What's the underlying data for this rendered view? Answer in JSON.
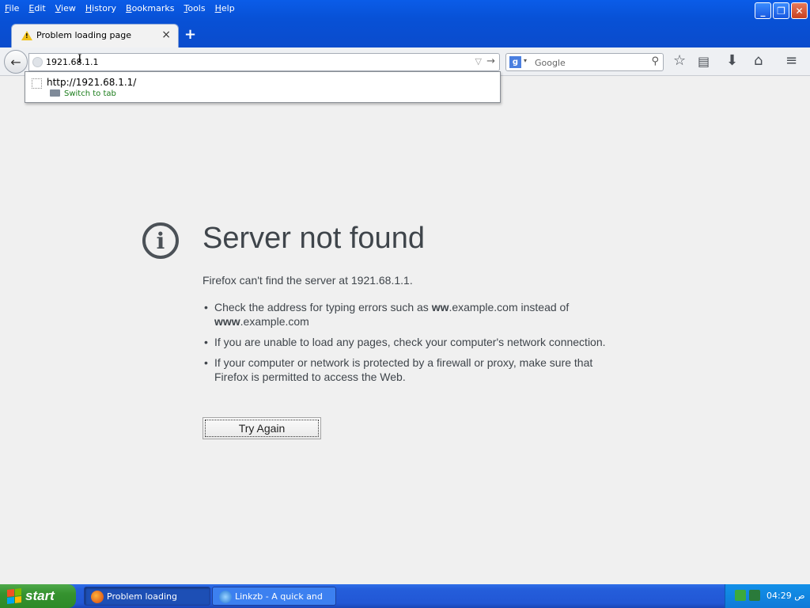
{
  "menu": [
    "File",
    "Edit",
    "View",
    "History",
    "Bookmarks",
    "Tools",
    "Help"
  ],
  "menu_underline": [
    "F",
    "E",
    "V",
    "H",
    "B",
    "T",
    "H"
  ],
  "tab": {
    "title": "Problem loading page",
    "close": "×",
    "new": "+"
  },
  "nav": {
    "url": "1921.68.1.1",
    "search_placeholder": "Google"
  },
  "dropdown": {
    "link": "http://1921.68.1.1/",
    "action": "Switch to tab"
  },
  "error": {
    "title": "Server not found",
    "short": "Firefox can't find the server at 1921.68.1.1.",
    "items": [
      {
        "pre": "Check the address for typing errors such as ",
        "b1": "ww",
        "mid": ".example.com instead of ",
        "b2": "www",
        "post": ".example.com"
      },
      {
        "text": "If you are unable to load any pages, check your computer's network connection."
      },
      {
        "text": "If your computer or network is protected by a firewall or proxy, make sure that Firefox is permitted to access the Web."
      }
    ],
    "button": "Try Again"
  },
  "taskbar": {
    "start": "start",
    "tasks": [
      "Problem loading page...",
      "Linkzb - A quick and s..."
    ],
    "time": "04:29 ص"
  },
  "colors": {
    "xp_blue": "#245edb",
    "start_green": "#35922f",
    "error_text": "#3f454b"
  }
}
